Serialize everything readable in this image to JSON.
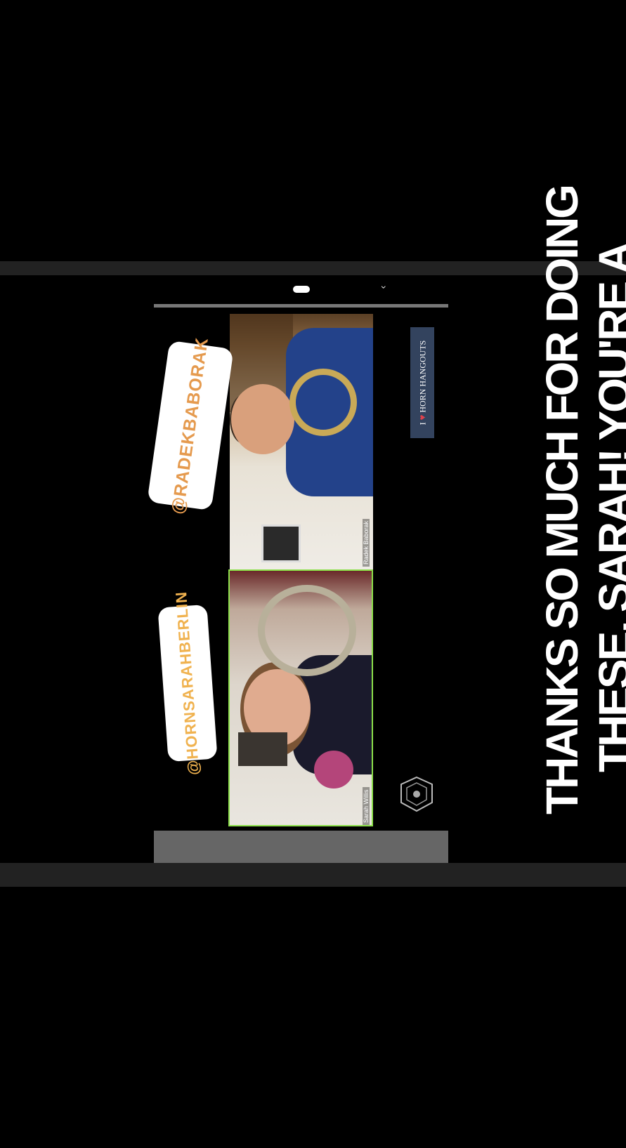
{
  "stickers": {
    "radek": "@RADEKBABORAK",
    "horn_sarah": "@HORNSARAHBERLIN"
  },
  "video_call": {
    "participants": [
      {
        "name": "Radek Baborak"
      },
      {
        "name": "Sarah Willis"
      }
    ]
  },
  "logos": {
    "horn_hangouts": {
      "prefix": "I",
      "heart": "♥",
      "suffix": "HORN HANGOUTS"
    }
  },
  "caption": {
    "line1": "THANKS SO MUCH FOR DOING",
    "line2": "THESE, SARAH! YOU'RE A"
  },
  "colors": {
    "active_speaker_border": "#8ce04a",
    "sticker_radek_text": "#e59a4e",
    "sticker_sarah_text": "#f0b24f",
    "logo_background": "#33435e"
  },
  "icons": [
    "chevron-down-icon",
    "drag-handle-icon",
    "crest-logo-icon",
    "heart-icon"
  ]
}
